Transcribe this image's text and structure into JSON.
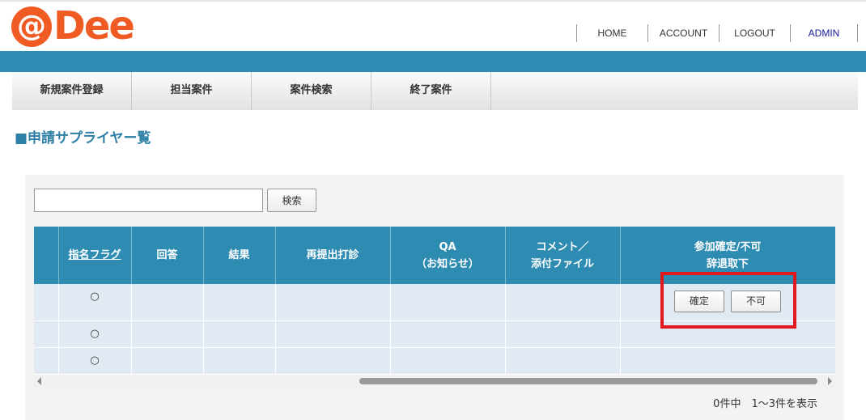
{
  "logo": {
    "at": "@",
    "text": "Dee"
  },
  "topnav": {
    "home": "HOME",
    "account": "ACCOUNT",
    "logout": "LOGOUT",
    "admin": "ADMIN"
  },
  "subnav": [
    "新規案件登録",
    "担当案件",
    "案件検索",
    "終了案件"
  ],
  "page_title": "■申請サプライヤー覧",
  "search": {
    "value": "",
    "placeholder": "",
    "button": "検索"
  },
  "table": {
    "headers": {
      "flag": "指名フラグ",
      "answer": "回答",
      "result": "結果",
      "resubmit": "再提出打診",
      "qa_1": "QA",
      "qa_2": "（お知らせ）",
      "comment_1": "コメント／",
      "comment_2": "添付ファイル",
      "confirm_1": "参加確定/不可",
      "confirm_2": "辞退取下"
    },
    "rows": [
      {
        "flag": "○",
        "confirm_btn": "確定",
        "reject_btn": "不可"
      },
      {
        "flag": "○"
      },
      {
        "flag": "○"
      }
    ]
  },
  "footer": {
    "count_text": "0件中　1～3件を表示"
  },
  "colors": {
    "brand": "#f05a23",
    "bar": "#2e8bb1",
    "header": "#2e8bb1",
    "title": "#2e7fa6",
    "highlight": "#e0191f"
  }
}
